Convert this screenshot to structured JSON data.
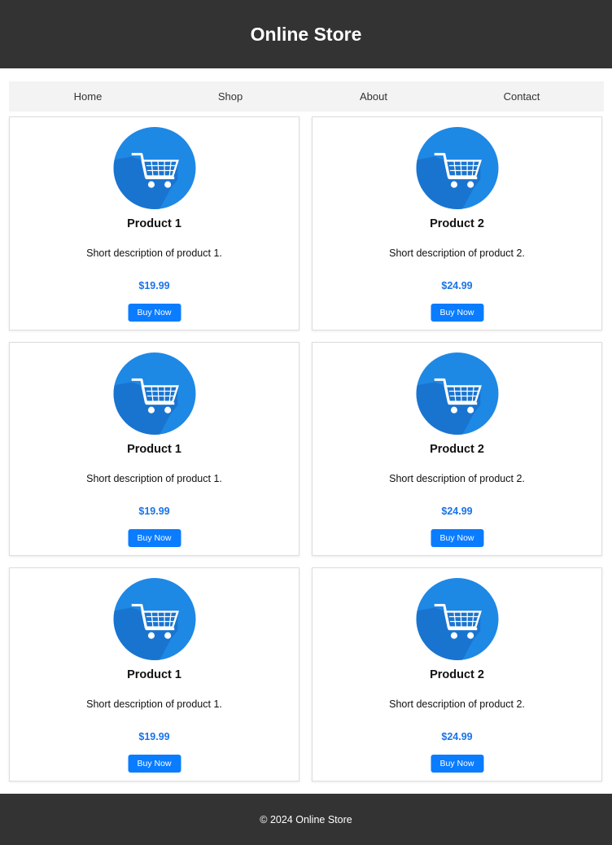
{
  "header": {
    "title": "Online Store"
  },
  "nav": {
    "items": [
      "Home",
      "Shop",
      "About",
      "Contact"
    ]
  },
  "products": [
    {
      "name": "Product 1",
      "description": "Short description of product 1.",
      "price": "$19.99",
      "button": "Buy Now",
      "icon": "shopping-cart-icon"
    },
    {
      "name": "Product 2",
      "description": "Short description of product 2.",
      "price": "$24.99",
      "button": "Buy Now",
      "icon": "shopping-cart-icon"
    },
    {
      "name": "Product 1",
      "description": "Short description of product 1.",
      "price": "$19.99",
      "button": "Buy Now",
      "icon": "shopping-cart-icon"
    },
    {
      "name": "Product 2",
      "description": "Short description of product 2.",
      "price": "$24.99",
      "button": "Buy Now",
      "icon": "shopping-cart-icon"
    },
    {
      "name": "Product 1",
      "description": "Short description of product 1.",
      "price": "$19.99",
      "button": "Buy Now",
      "icon": "shopping-cart-icon"
    },
    {
      "name": "Product 2",
      "description": "Short description of product 2.",
      "price": "$24.99",
      "button": "Buy Now",
      "icon": "shopping-cart-icon"
    }
  ],
  "footer": {
    "text": "© 2024 Online Store"
  },
  "colors": {
    "header_bg": "#333333",
    "nav_bg": "#f3f3f3",
    "accent": "#0a7cff",
    "price": "#1a73e8",
    "icon_circle": "#1e88e5"
  }
}
